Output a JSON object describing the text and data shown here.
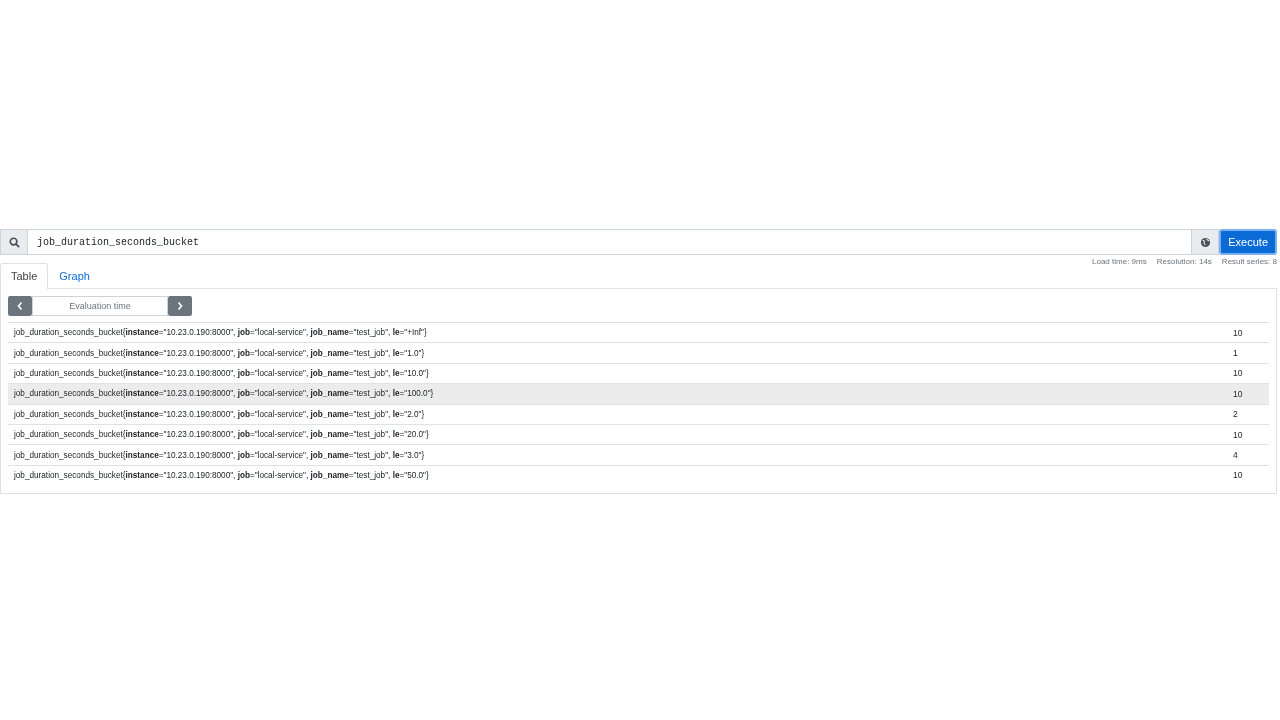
{
  "query": {
    "value": "job_duration_seconds_bucket"
  },
  "execute_button": "Execute",
  "tabs": [
    {
      "label": "Table",
      "selected": true
    },
    {
      "label": "Graph",
      "selected": false
    }
  ],
  "stats": [
    "Load time: 9ms",
    "Resolution: 14s",
    "Result series: 8"
  ],
  "evaluation_time": {
    "placeholder": "Evaluation time"
  },
  "rows": [
    {
      "series": "job_duration_seconds_bucket{**instance**=\"10.23.0.190:8000\", **job**=\"local-service\", **job_name**=\"test_job\", **le**=\"+Inf\"}",
      "value": "10",
      "highlighted": false
    },
    {
      "series": "job_duration_seconds_bucket{**instance**=\"10.23.0.190:8000\", **job**=\"local-service\", **job_name**=\"test_job\", **le**=\"1.0\"}",
      "value": "1",
      "highlighted": false
    },
    {
      "series": "job_duration_seconds_bucket{**instance**=\"10.23.0.190:8000\", **job**=\"local-service\", **job_name**=\"test_job\", **le**=\"10.0\"}",
      "value": "10",
      "highlighted": false
    },
    {
      "series": "job_duration_seconds_bucket{**instance**=\"10.23.0.190:8000\", **job**=\"local-service\", **job_name**=\"test_job\", **le**=\"100.0\"}",
      "value": "10",
      "highlighted": true
    },
    {
      "series": "job_duration_seconds_bucket{**instance**=\"10.23.0.190:8000\", **job**=\"local-service\", **job_name**=\"test_job\", **le**=\"2.0\"}",
      "value": "2",
      "highlighted": false
    },
    {
      "series": "job_duration_seconds_bucket{**instance**=\"10.23.0.190:8000\", **job**=\"local-service\", **job_name**=\"test_job\", **le**=\"20.0\"}",
      "value": "10",
      "highlighted": false
    },
    {
      "series": "job_duration_seconds_bucket{**instance**=\"10.23.0.190:8000\", **job**=\"local-service\", **job_name**=\"test_job\", **le**=\"3.0\"}",
      "value": "4",
      "highlighted": false
    },
    {
      "series": "job_duration_seconds_bucket{**instance**=\"10.23.0.190:8000\", **job**=\"local-service\", **job_name**=\"test_job\", **le**=\"50.0\"}",
      "value": "10",
      "highlighted": false
    }
  ]
}
